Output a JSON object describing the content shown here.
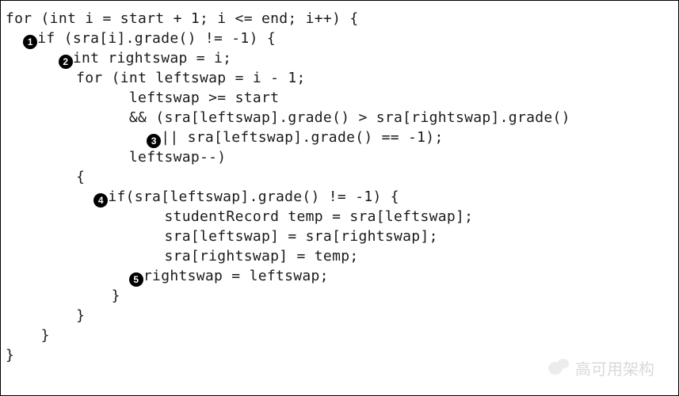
{
  "code": {
    "lines": [
      {
        "indent": 0,
        "bullet": null,
        "text": "for (int i = start + 1; i <= end; i++) {"
      },
      {
        "indent": 1,
        "bullet": "1",
        "text": "if (sra[i].grade() != -1) {"
      },
      {
        "indent": 3,
        "bullet": "2",
        "text": "int rightswap = i;"
      },
      {
        "indent": 4,
        "bullet": null,
        "text": "for (int leftswap = i - 1;"
      },
      {
        "indent": 7,
        "bullet": null,
        "text": "leftswap >= start"
      },
      {
        "indent": 7,
        "bullet": null,
        "text": "&& (sra[leftswap].grade() > sra[rightswap].grade()"
      },
      {
        "indent": 8,
        "bullet": "3",
        "text": "|| sra[leftswap].grade() == -1);"
      },
      {
        "indent": 7,
        "bullet": null,
        "text": "leftswap--)"
      },
      {
        "indent": 4,
        "bullet": null,
        "text": "{"
      },
      {
        "indent": 5,
        "bullet": "4",
        "text": "if(sra[leftswap].grade() != -1) {"
      },
      {
        "indent": 9,
        "bullet": null,
        "text": "studentRecord temp = sra[leftswap];"
      },
      {
        "indent": 9,
        "bullet": null,
        "text": "sra[leftswap] = sra[rightswap];"
      },
      {
        "indent": 9,
        "bullet": null,
        "text": "sra[rightswap] = temp;"
      },
      {
        "indent": 7,
        "bullet": "5",
        "text": "rightswap = leftswap;"
      },
      {
        "indent": 6,
        "bullet": null,
        "text": "}"
      },
      {
        "indent": 4,
        "bullet": null,
        "text": "}"
      },
      {
        "indent": 2,
        "bullet": null,
        "text": "}"
      },
      {
        "indent": 0,
        "bullet": null,
        "text": "}"
      }
    ]
  },
  "watermark": {
    "text": "高可用架构"
  }
}
